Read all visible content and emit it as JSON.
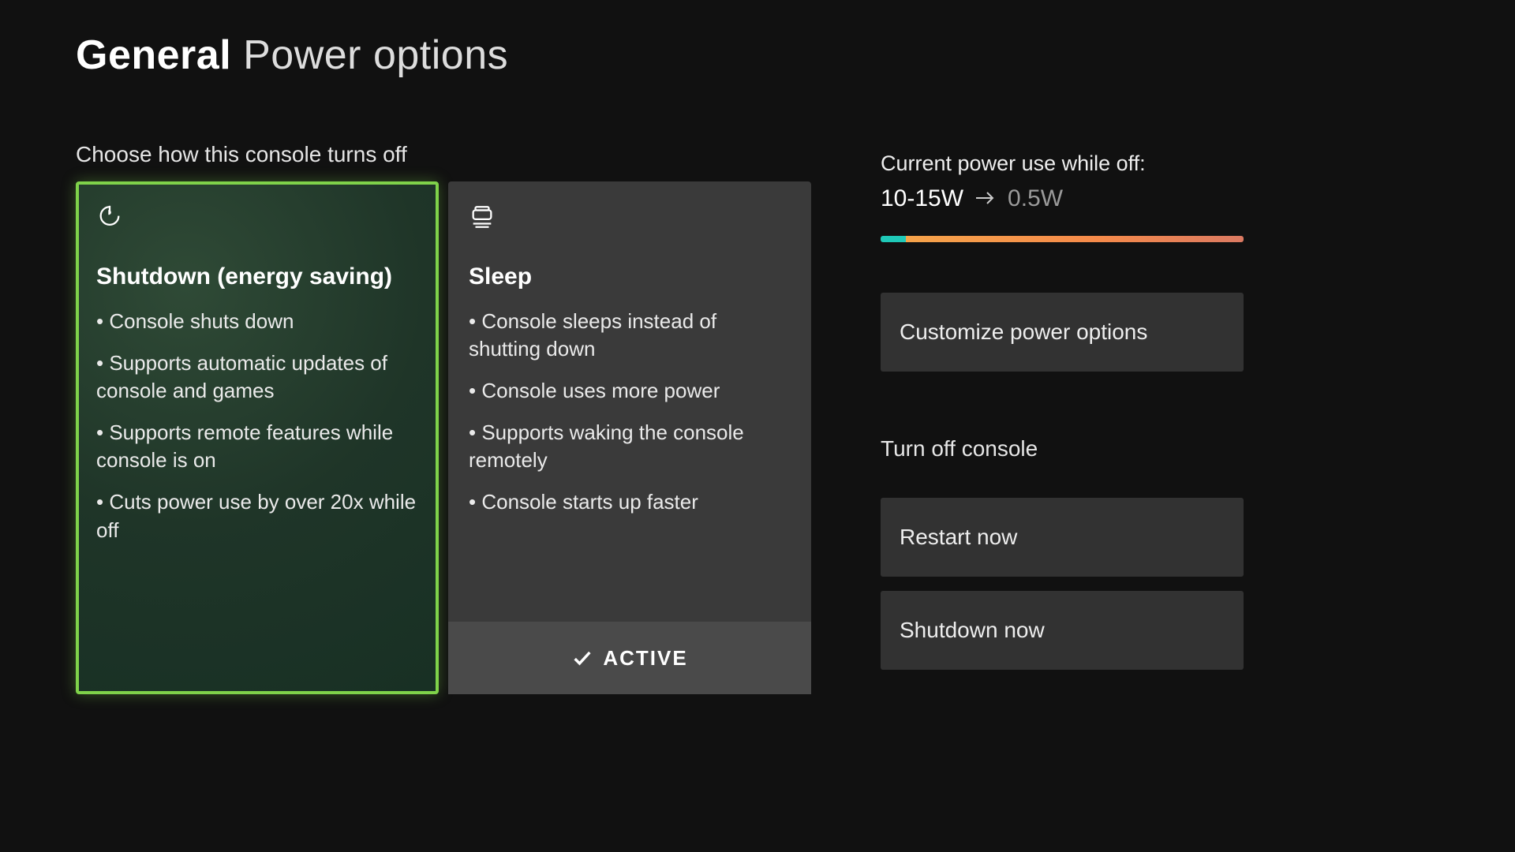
{
  "header": {
    "category": "General",
    "page": "Power options"
  },
  "mode_section_label": "Choose how this console turns off",
  "cards": [
    {
      "title": "Shutdown (energy saving)",
      "icon": "leaf-power-icon",
      "selected": true,
      "active": false,
      "bullets": [
        "Console shuts down",
        "Supports automatic updates of console and games",
        "Supports remote features while console is on",
        "Cuts power use by over 20x while off"
      ]
    },
    {
      "title": "Sleep",
      "icon": "sleep-stack-icon",
      "selected": false,
      "active": true,
      "bullets": [
        "Console sleeps instead of shutting down",
        "Console uses more power",
        "Supports waking the console remotely",
        "Console starts up faster"
      ]
    }
  ],
  "active_label": "ACTIVE",
  "power_use": {
    "label": "Current power use while off:",
    "from": "10-15W",
    "to": "0.5W"
  },
  "customize_button": "Customize power options",
  "turn_off_section_label": "Turn off console",
  "restart_button": "Restart now",
  "shutdown_button": "Shutdown now"
}
